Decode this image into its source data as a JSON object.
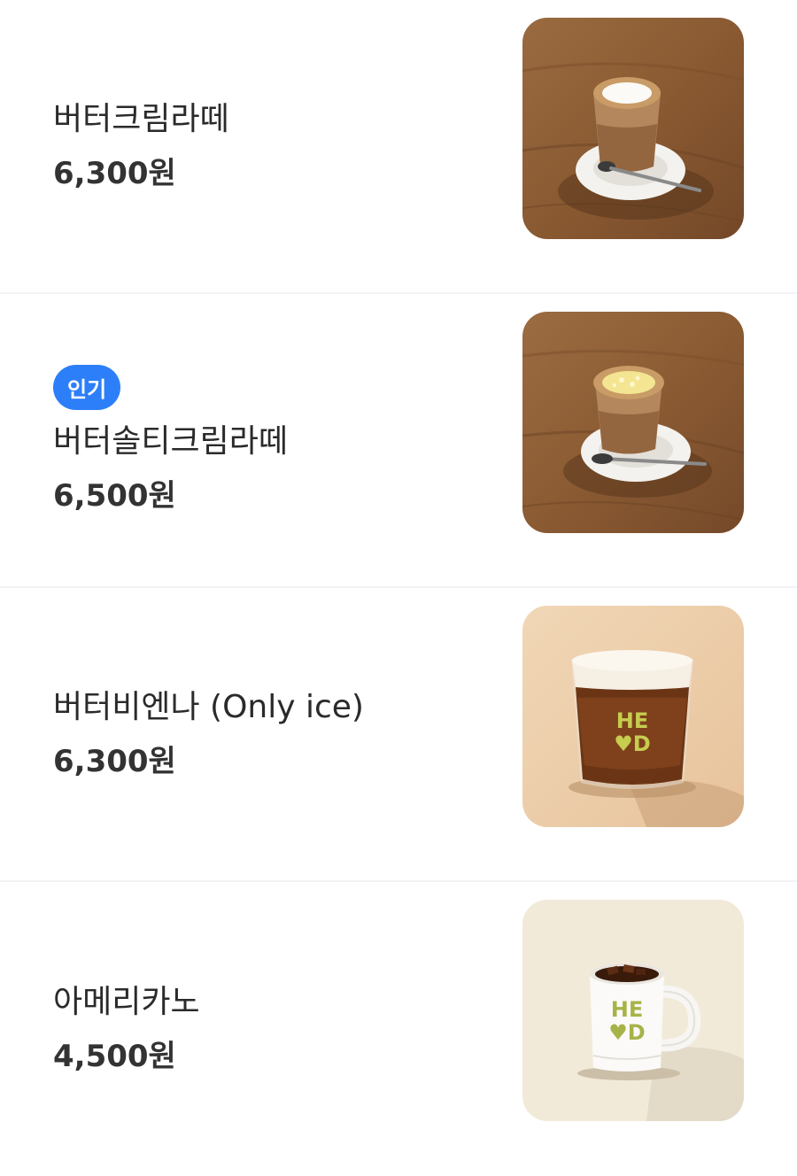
{
  "items": [
    {
      "name": "버터크림라떼",
      "price": "6,300원",
      "image_icon": "butter-cream-latte-photo"
    },
    {
      "badge": "인기",
      "name": "버터솔티크림라떼",
      "price": "6,500원",
      "image_icon": "butter-salty-cream-latte-photo"
    },
    {
      "name": "버터비엔나 (Only ice)",
      "price": "6,300원",
      "image_icon": "butter-vienna-photo"
    },
    {
      "name": "아메리카노",
      "price": "4,500원",
      "image_icon": "americano-photo"
    }
  ],
  "colors": {
    "badge_bg": "#2d7ff9",
    "divider": "#f1f2f4"
  }
}
